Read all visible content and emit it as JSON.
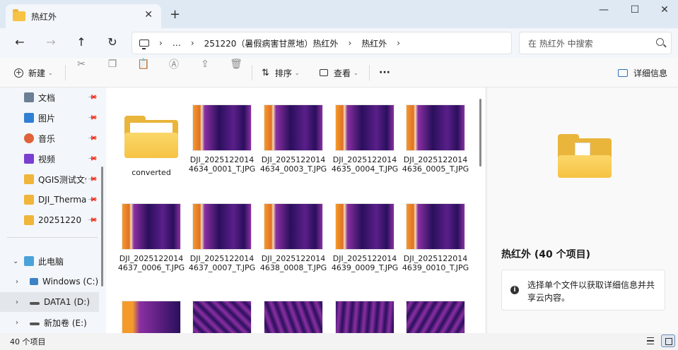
{
  "window": {
    "tab_title": "热红外",
    "tab_close": "✕",
    "new_tab": "+",
    "minimize": "—",
    "maximize": "☐",
    "close": "✕"
  },
  "nav": {
    "back": "←",
    "forward": "→",
    "up": "↑",
    "refresh": "↻",
    "breadcrumb": [
      "…",
      "251220（暑假病害甘蔗地）热红外",
      "热红外"
    ],
    "search_placeholder": "在 热红外 中搜索"
  },
  "toolbar": {
    "new_label": "新建",
    "sort_label": "排序",
    "view_label": "查看",
    "more_label": "···",
    "details_label": "详细信息"
  },
  "sidebar": {
    "quick_access": [
      {
        "label": "文档",
        "icon": "documents-icon",
        "color": "#6b7f95"
      },
      {
        "label": "图片",
        "icon": "pictures-icon",
        "color": "#2f7fd4"
      },
      {
        "label": "音乐",
        "icon": "music-icon",
        "color": "#e0623a"
      },
      {
        "label": "视频",
        "icon": "videos-icon",
        "color": "#7a3fd0"
      },
      {
        "label": "QGIS测试文件",
        "icon": "folder-icon",
        "color": "#f0b53a"
      },
      {
        "label": "DJI_Thermal_",
        "icon": "folder-icon",
        "color": "#f0b53a"
      },
      {
        "label": "20251220",
        "icon": "folder-icon",
        "color": "#f0b53a"
      }
    ],
    "this_pc": "此电脑",
    "drives": [
      {
        "label": "Windows (C:)",
        "icon": "windows-drive-icon"
      },
      {
        "label": "DATA1 (D:)",
        "icon": "drive-icon"
      },
      {
        "label": "新加卷 (E:)",
        "icon": "drive-icon"
      }
    ]
  },
  "files": [
    {
      "name": "converted",
      "type": "folder"
    },
    {
      "name": "DJI_20251220144634_0001_T.JPG",
      "type": "thermal"
    },
    {
      "name": "DJI_20251220144634_0003_T.JPG",
      "type": "thermal"
    },
    {
      "name": "DJI_20251220144635_0004_T.JPG",
      "type": "thermal"
    },
    {
      "name": "DJI_20251220144636_0005_T.JPG",
      "type": "thermal"
    },
    {
      "name": "DJI_20251220144637_0006_T.JPG",
      "type": "thermal"
    },
    {
      "name": "DJI_20251220144637_0007_T.JPG",
      "type": "thermal"
    },
    {
      "name": "DJI_20251220144638_0008_T.JPG",
      "type": "thermal"
    },
    {
      "name": "DJI_20251220144639_0009_T.JPG",
      "type": "thermal"
    },
    {
      "name": "DJI_20251220144639_0010_T.JPG",
      "type": "thermal"
    },
    {
      "name": "",
      "type": "thermal"
    },
    {
      "name": "",
      "type": "thermal"
    },
    {
      "name": "",
      "type": "thermal"
    },
    {
      "name": "",
      "type": "thermal"
    },
    {
      "name": "",
      "type": "thermal"
    }
  ],
  "details": {
    "title": "热红外 (40 个项目)",
    "info": "选择单个文件以获取详细信息并共享云内容。"
  },
  "status": {
    "item_count": "40 个项目"
  },
  "colors": {
    "thermal_dark": "#2a0f5c",
    "thermal_mid": "#8b2fa3",
    "thermal_hot": "#f49a2a",
    "accent": "#f6c344"
  }
}
